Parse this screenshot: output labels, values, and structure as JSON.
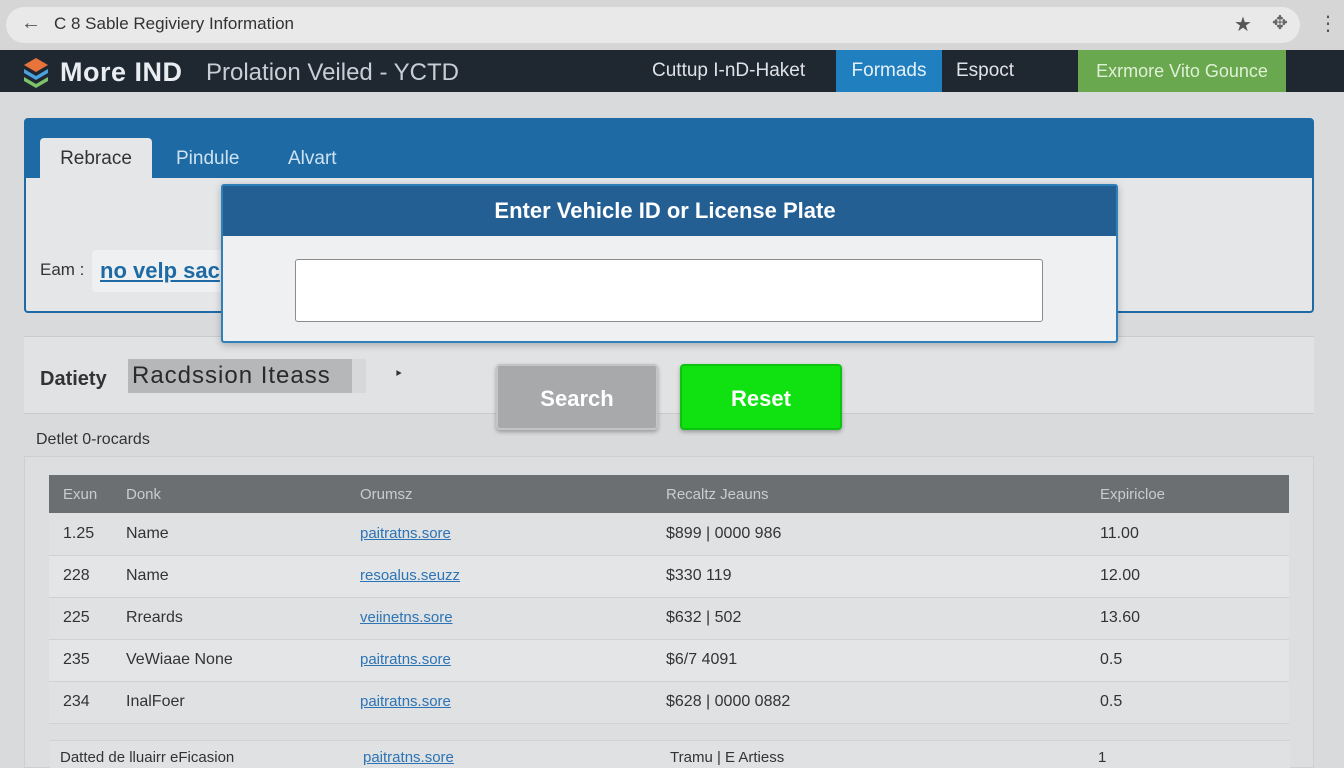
{
  "browser": {
    "back_icon": "back-arrow-icon",
    "url_text": "C 8 Sable Regiviery Information",
    "star_icon": "star-icon",
    "extension_icon": "extension-icon",
    "menu_icon": "kebab-menu-icon"
  },
  "navbar": {
    "brand_title": "More IND",
    "brand_subtitle": "Prolation Veiled - YCTD",
    "links": [
      "Cuttup I-nD-Haket",
      "Formads",
      "Espoct"
    ],
    "cta_label": "Exrmore Vito Gounce",
    "colors": {
      "bar": "#1f2730",
      "active": "#1f7fbf",
      "cta": "#6aa84f"
    }
  },
  "top_panel": {
    "tabs": [
      "Rebrace",
      "Pindule",
      "Alvart"
    ],
    "field_label": "Eam :",
    "help_link": "no velp sac"
  },
  "middle": {
    "label": "Datiety",
    "process_box": "Racdssion Iteass",
    "drag_icon": "drag-handle-icon",
    "records_heading": "Detlet 0-rocards"
  },
  "table": {
    "headers": [
      "Exun",
      "Donk",
      "Orumsz",
      "Recaltz Jeauns",
      "Expiricloe"
    ],
    "rows": [
      [
        "1.25",
        "Name",
        "paitratns.sore",
        "$899 | 0000  986",
        "11.00"
      ],
      [
        "228",
        "Name",
        "resoalus.seuzz",
        "$330 119",
        "12.00"
      ],
      [
        "225",
        "Rreards",
        "veiinetns.sore",
        "$632 | 502",
        "13.60"
      ],
      [
        "235",
        "VeWiaae None",
        "paitratns.sore",
        "$6/7  4091",
        "0.5"
      ],
      [
        "234",
        "InalFoer",
        "paitratns.sore",
        "$628 | 0000 0882",
        "0.5"
      ]
    ],
    "footer": [
      "Datted de lluairr eFicasion",
      "paitratns.sore",
      "Tramu | E Artiess",
      "1"
    ]
  },
  "modal": {
    "title": "Enter Vehicle ID or License Plate",
    "input_value": "",
    "input_placeholder": "",
    "search_label": "Search",
    "reset_label": "Reset",
    "colors": {
      "header": "#245f94",
      "search": "#a7a9ab",
      "reset": "#10e212"
    }
  }
}
